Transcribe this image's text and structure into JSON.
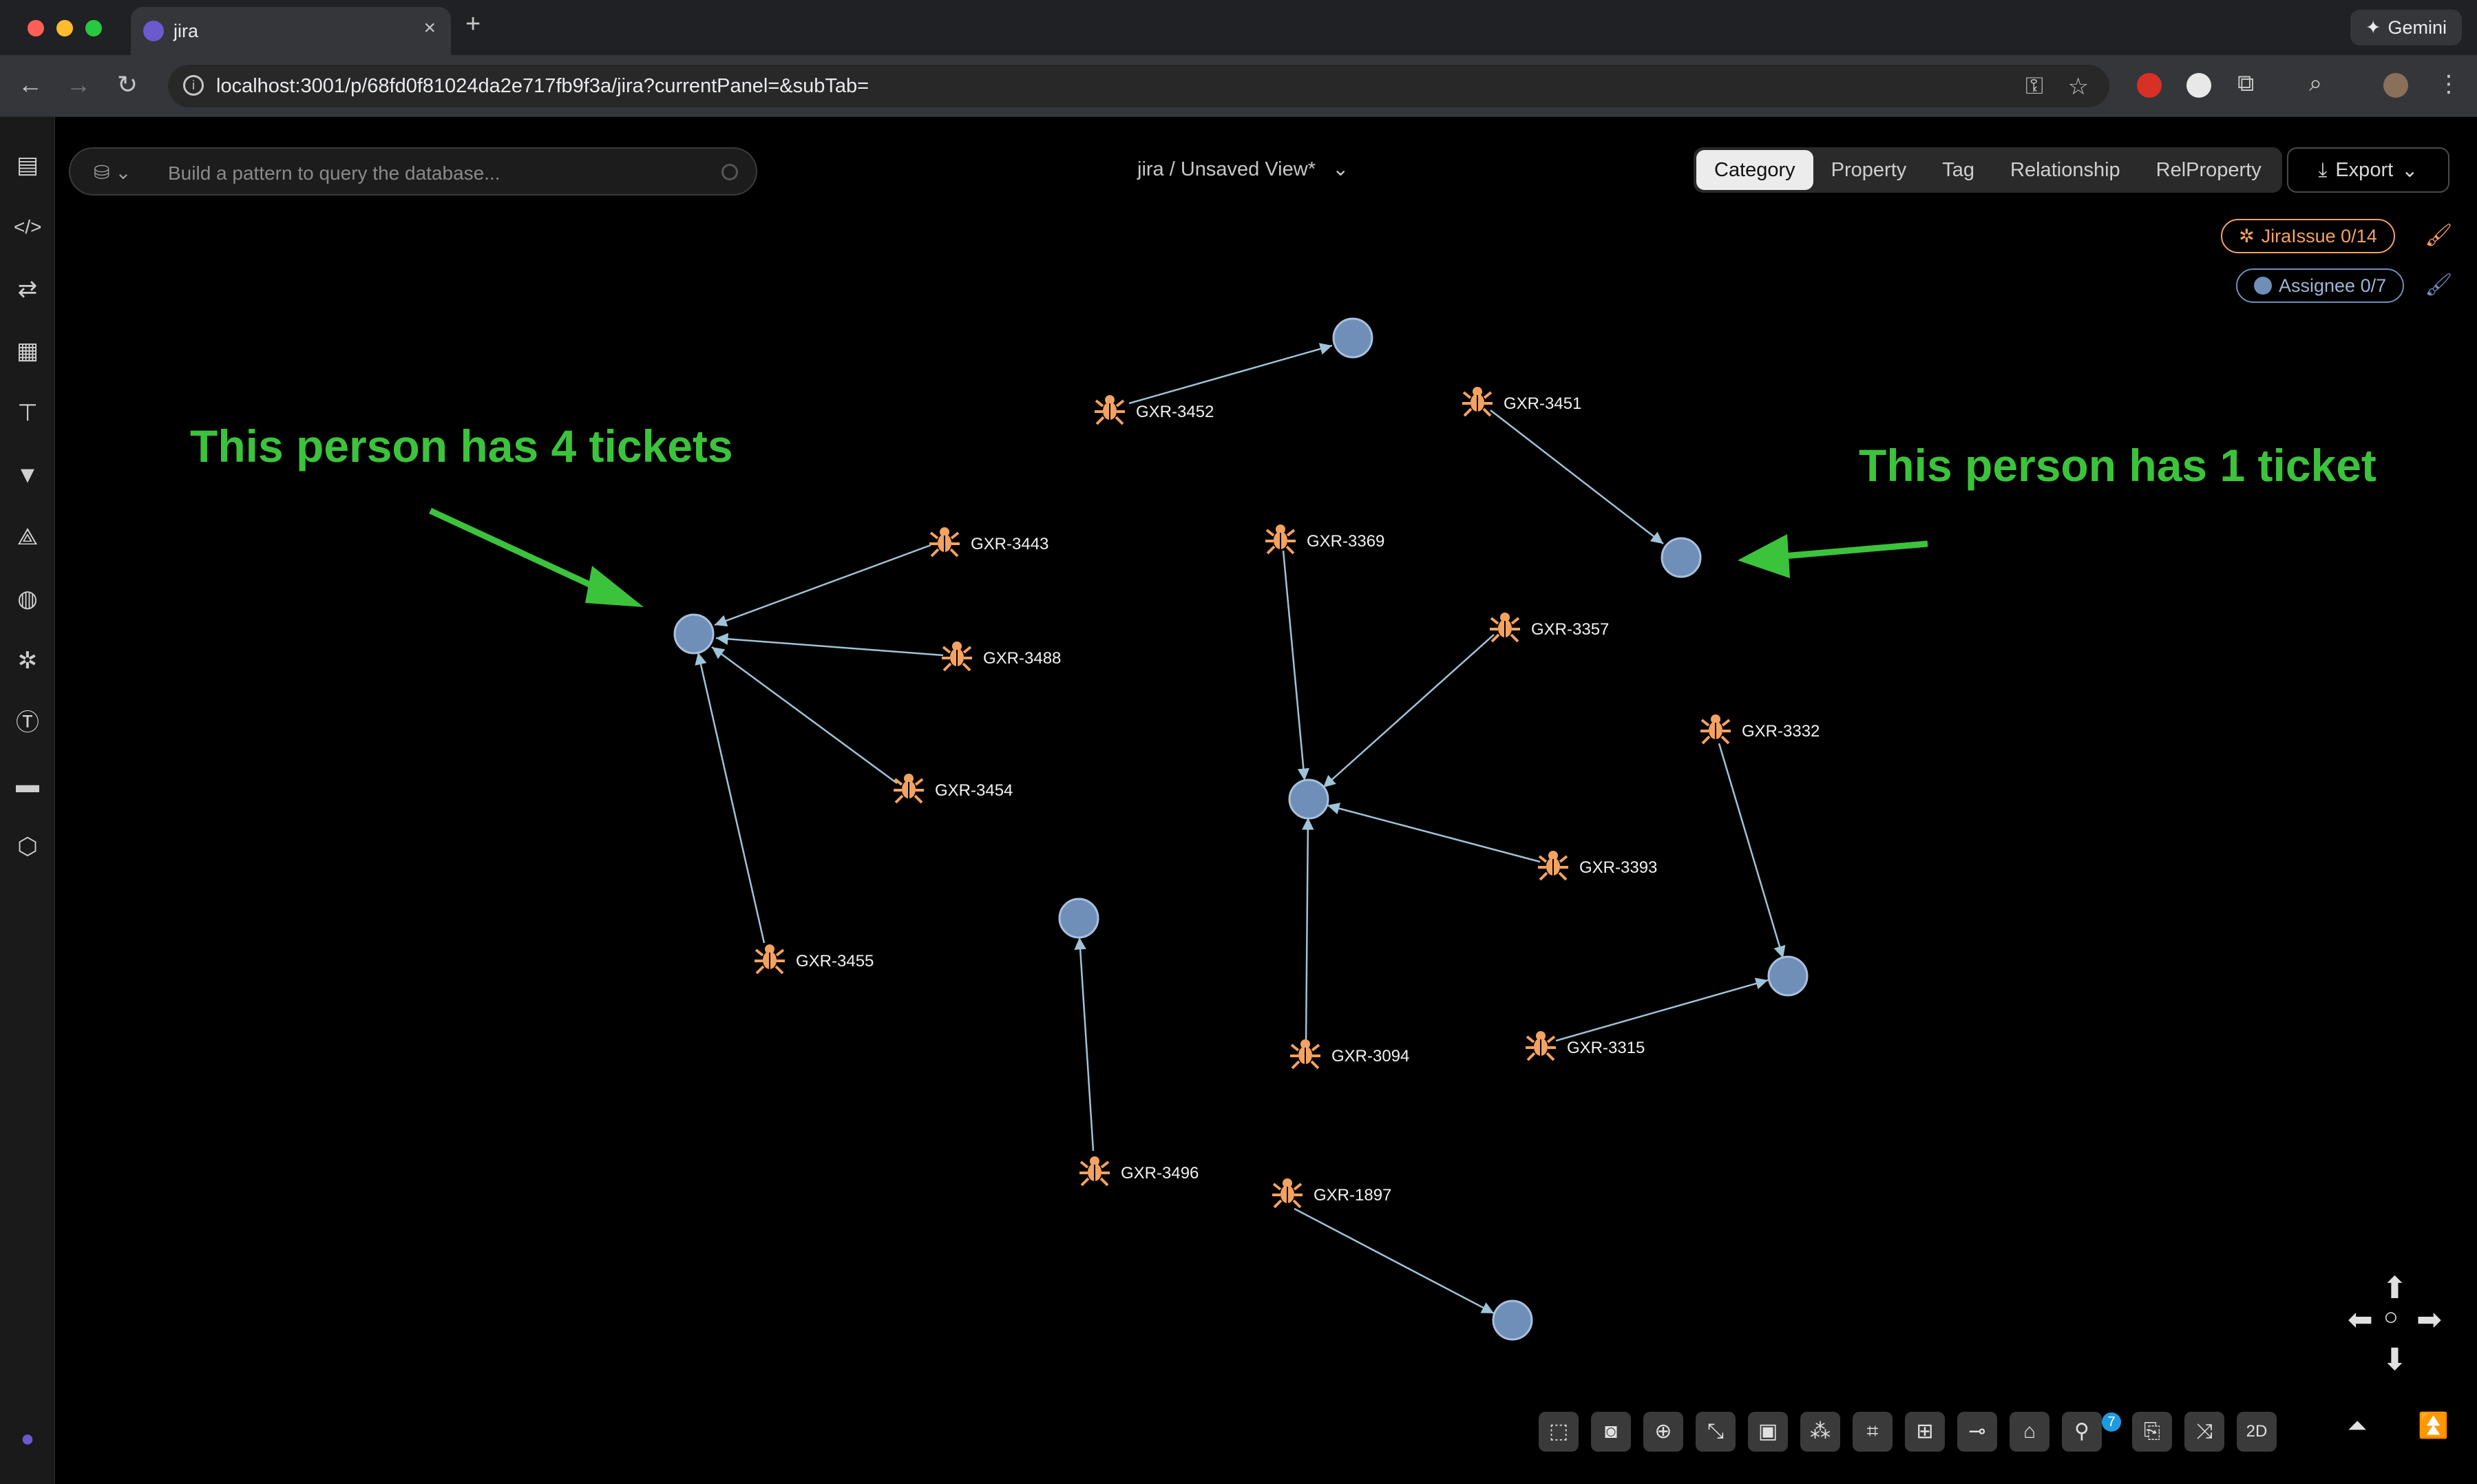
{
  "browser": {
    "tab_title": "jira",
    "url": "localhost:3001/p/68fd0f81024da2e717fb9f3a/jira?currentPanel=&subTab=",
    "gemini_label": "Gemini"
  },
  "query": {
    "placeholder": "Build a pattern to query the database..."
  },
  "view": {
    "title": "jira / Unsaved View*"
  },
  "mode_tabs": [
    "Category",
    "Property",
    "Tag",
    "Relationship",
    "RelProperty"
  ],
  "active_mode": "Category",
  "export_label": "Export",
  "legend": {
    "issue_label": "JiraIssue 0/14",
    "assignee_label": "Assignee 0/7",
    "issue_color": "#f4a261",
    "assignee_color": "#6f8fb8"
  },
  "annotations": {
    "left": "This person has 4 tickets",
    "right": "This person has 1 ticket",
    "color": "#3cc33c"
  },
  "graph": {
    "issues": [
      "GXR-3452",
      "GXR-3451",
      "GXR-3443",
      "GXR-3369",
      "GXR-3488",
      "GXR-3357",
      "GXR-3454",
      "GXR-3332",
      "GXR-3393",
      "GXR-3455",
      "GXR-3094",
      "GXR-3315",
      "GXR-3496",
      "GXR-1897"
    ],
    "assignee_count": 7
  },
  "bottom_toolbar": {
    "pin_badge": "7",
    "mode_2d": "2D"
  }
}
